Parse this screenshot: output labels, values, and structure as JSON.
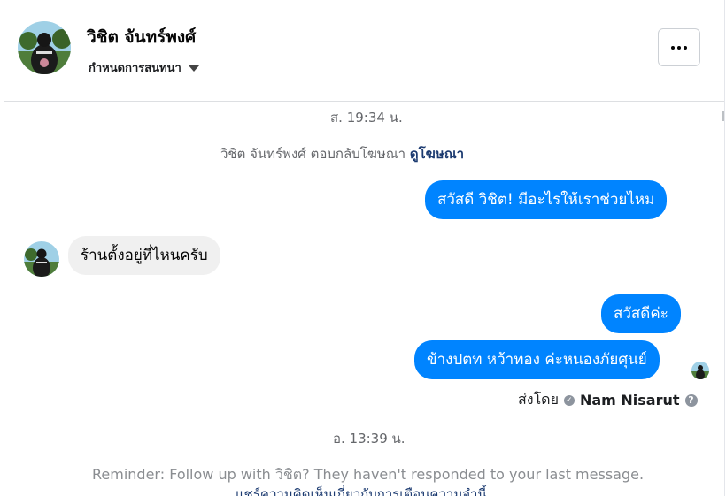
{
  "header": {
    "contact_name": "วิชิต จันทร์พงศ์",
    "conversation_settings": "กำหนดการสนทนา"
  },
  "thread": {
    "timestamp_1": "ส. 19:34 น.",
    "system_message_text": "วิชิต จันทร์พงศ์ ตอบกลับโฆษณา",
    "system_message_link": "ดูโฆษณา",
    "msg_out_1": "สวัสดี วิชิต! มีอะไรให้เราช่วยไหม",
    "msg_in_1": "ร้านตั้งอยู่ที่ไหนครับ",
    "msg_out_2": "สวัสดีค่ะ",
    "msg_out_3": "ข้างปตท หว้าทอง ค่ะหนองภัยศุนย์",
    "sent_by_label": "ส่งโดย",
    "sender_name": "Nam Nisarut",
    "timestamp_2": "อ. 13:39 น.",
    "reminder_text": "Reminder: Follow up with วิชิต? They haven't responded to your last message.",
    "reminder_link_text": "แชร์ความคิดเห็นเกี่ยวกับการเตือนความจำนี้"
  },
  "colors": {
    "outgoing_bubble": "#0084ff",
    "incoming_bubble": "#f0f0f0",
    "link": "#1b3a70",
    "muted_text": "#65676b"
  },
  "icons": {
    "more": "more-dots-icon",
    "dropdown": "caret-down-icon",
    "help": "question-icon",
    "verified": "check-circle-icon"
  }
}
